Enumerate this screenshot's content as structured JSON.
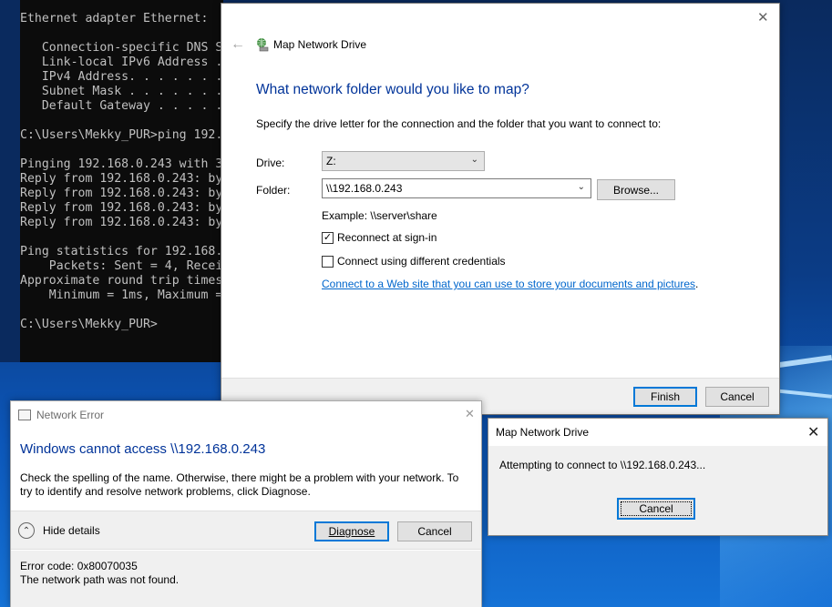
{
  "console": {
    "lines": [
      "Ethernet adapter Ethernet:",
      "",
      "   Connection-specific DNS S",
      "   Link-local IPv6 Address .",
      "   IPv4 Address. . . . . . .",
      "   Subnet Mask . . . . . . .",
      "   Default Gateway . . . . .",
      "",
      "C:\\Users\\Mekky_PUR>ping 192.",
      "",
      "Pinging 192.168.0.243 with 3",
      "Reply from 192.168.0.243: by",
      "Reply from 192.168.0.243: by",
      "Reply from 192.168.0.243: by",
      "Reply from 192.168.0.243: by",
      "",
      "Ping statistics for 192.168.",
      "    Packets: Sent = 4, Recei",
      "Approximate round trip times",
      "    Minimum = 1ms, Maximum =",
      "",
      "C:\\Users\\Mekky_PUR>"
    ]
  },
  "wizard": {
    "title": "Map Network Drive",
    "heading": "What network folder would you like to map?",
    "instructions": "Specify the drive letter for the connection and the folder that you want to connect to:",
    "drive_label": "Drive:",
    "drive_value": "Z:",
    "folder_label": "Folder:",
    "folder_value": "\\\\192.168.0.243",
    "browse_label": "Browse...",
    "example": "Example: \\\\server\\share",
    "reconnect_label": "Reconnect at sign-in",
    "reconnect_checked": true,
    "credentials_label": "Connect using different credentials",
    "credentials_checked": false,
    "link_text": "Connect to a Web site that you can use to store your documents and pictures",
    "link_suffix": ".",
    "finish_label": "Finish",
    "cancel_label": "Cancel"
  },
  "network_error": {
    "title": "Network Error",
    "heading": "Windows cannot access \\\\192.168.0.243",
    "message": "Check the spelling of the name. Otherwise, there might be a problem with your network. To try to identify and resolve network problems, click Diagnose.",
    "hide_details_label": "Hide details",
    "diagnose_label": "Diagnose",
    "cancel_label": "Cancel",
    "error_code": "Error code: 0x80070035",
    "error_text": "The network path was not found."
  },
  "progress_dialog": {
    "title": "Map Network Drive",
    "message": "Attempting to connect to \\\\192.168.0.243...",
    "cancel_label": "Cancel"
  },
  "colors": {
    "heading_blue": "#003399",
    "link_blue": "#0066cc",
    "accent": "#0078d7"
  }
}
